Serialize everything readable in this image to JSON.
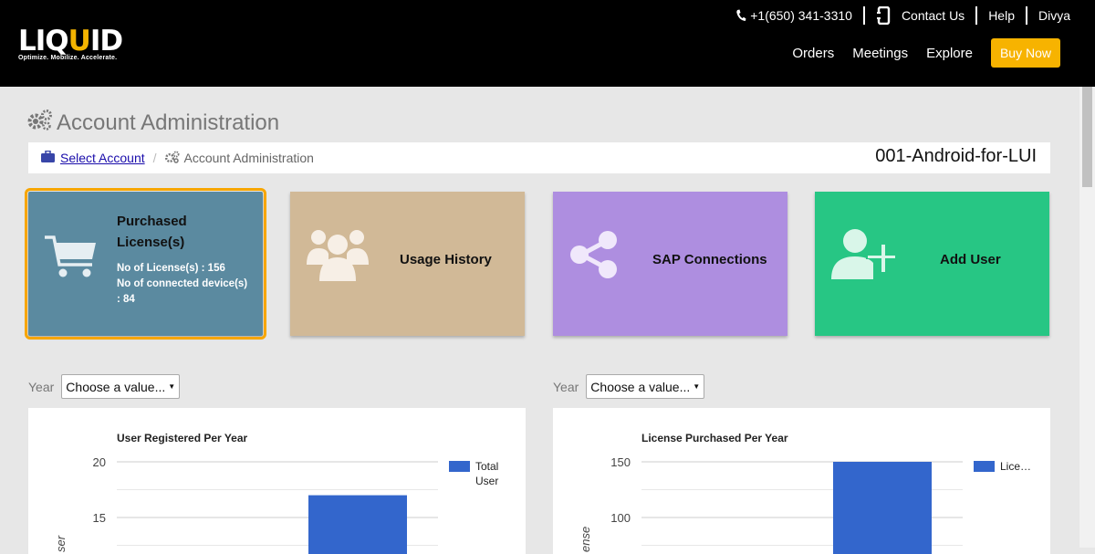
{
  "brand": {
    "name_pre": "LIQ",
    "name_accent": "U",
    "name_post": "ID",
    "tagline": "Optimize. Mobilize. Accelerate."
  },
  "top_links": {
    "phone": "+1(650) 341-3310",
    "contact": "Contact Us",
    "help": "Help",
    "user": "Divya"
  },
  "nav": {
    "orders": "Orders",
    "meetings": "Meetings",
    "explore": "Explore",
    "buy_now": "Buy Now"
  },
  "page": {
    "title": "Account Administration"
  },
  "breadcrumb": {
    "link": "Select Account",
    "current": "Account Administration",
    "account_name": "001-Android-for-LUI"
  },
  "tiles": [
    {
      "label": "Purchased License(s)",
      "licenses": "No of License(s) : 156",
      "devices": "No of connected device(s) : 84",
      "color": "#5b8aa0"
    },
    {
      "label": "Usage History",
      "color": "#d1b997"
    },
    {
      "label": "SAP Connections",
      "color": "#ae8ee0"
    },
    {
      "label": "Add User",
      "color": "#27c684"
    }
  ],
  "filters": {
    "year_label": "Year",
    "select_placeholder": "Choose a value..."
  },
  "chart_data": [
    {
      "type": "bar",
      "title": "User Registered Per Year",
      "ylabel": "User",
      "ylabel_visible": "ser",
      "y_ticks": [
        20,
        15
      ],
      "ylim": [
        10,
        20
      ],
      "series": [
        {
          "name": "Total User",
          "values": [
            17
          ]
        }
      ],
      "legend": [
        "Total",
        "User"
      ],
      "color": "#3366cc"
    },
    {
      "type": "bar",
      "title": "License Purchased Per Year",
      "ylabel": "License",
      "ylabel_visible": "ense",
      "y_ticks": [
        150,
        100
      ],
      "ylim": [
        50,
        150
      ],
      "series": [
        {
          "name": "Lice…",
          "values": [
            150
          ]
        }
      ],
      "legend": [
        "Lice…"
      ],
      "color": "#3366cc"
    }
  ]
}
